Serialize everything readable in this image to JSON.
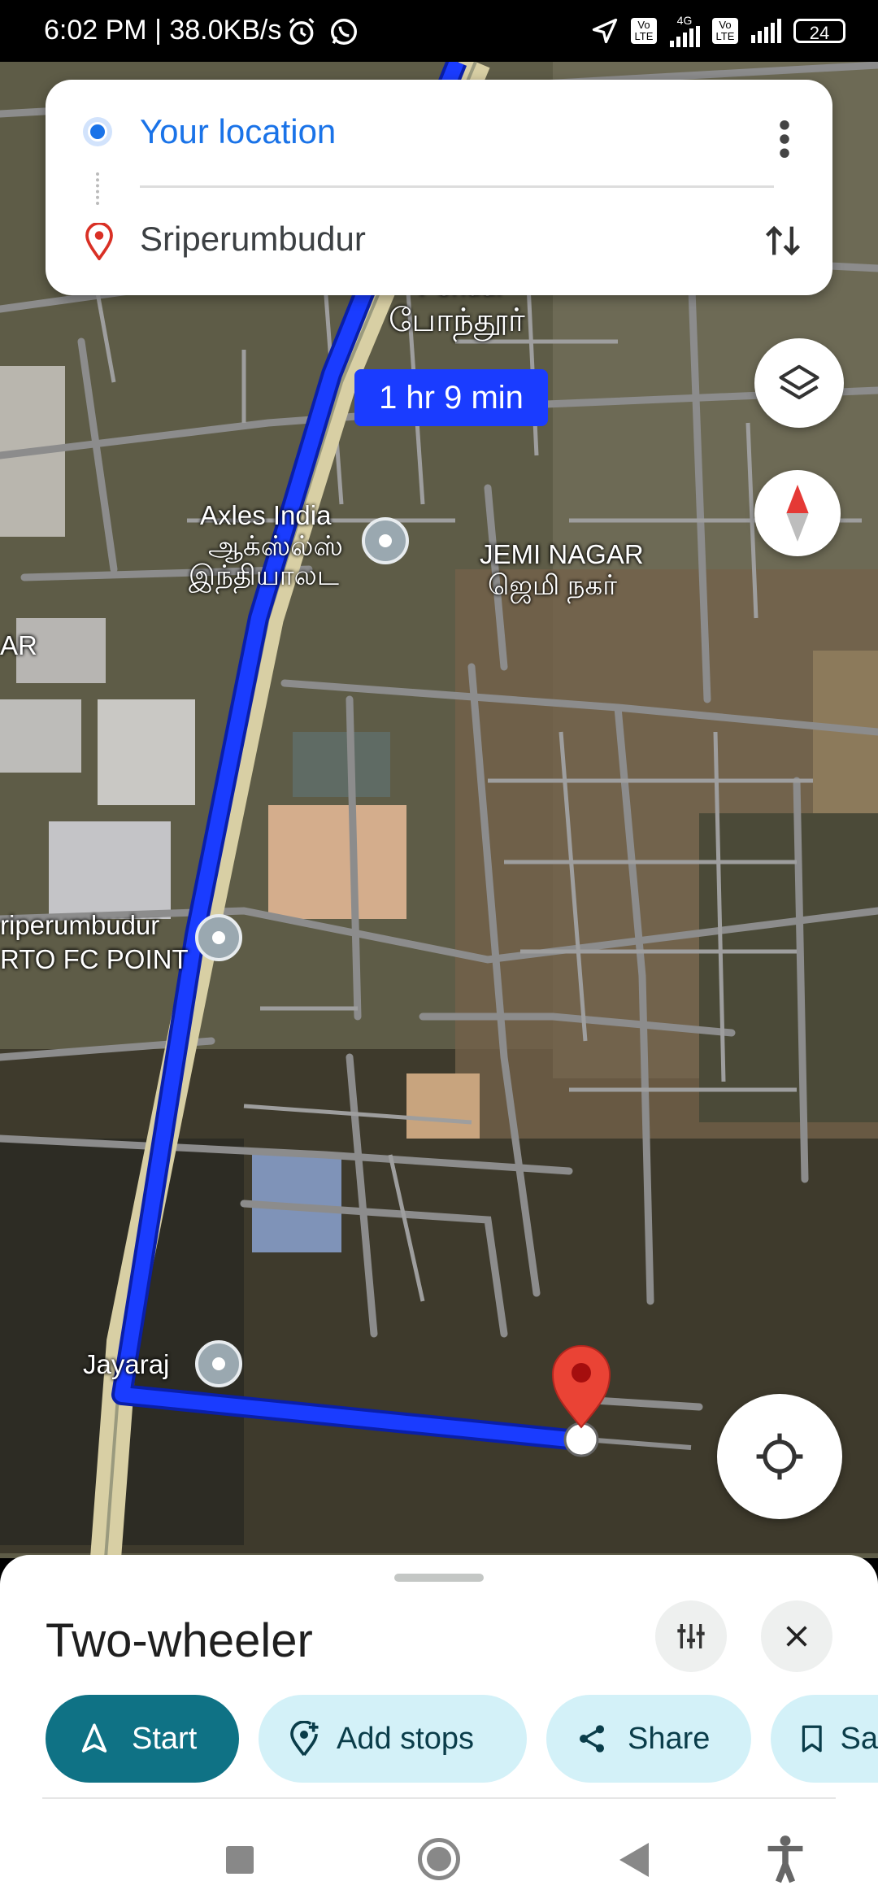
{
  "status_bar": {
    "time_speed": "6:02 PM | 38.0KB/s",
    "network": "4G",
    "volte_1": "Vo LTE",
    "volte_2": "Vo LTE",
    "battery": "24"
  },
  "directions": {
    "origin": "Your location",
    "destination": "Sriperumbudur",
    "route_duration": "1 hr 9 min"
  },
  "map_labels": {
    "pondur_en": "Pondur",
    "pondur_ta": "போந்தூர்",
    "axles_en": "Axles India",
    "axles_ta_1": "ஆக்ஸ்ல்ஸ்",
    "axles_ta_2": "இந்தியாலட",
    "jemi_en": "JEMI NAGAR",
    "jemi_ta": "ஜெமி நகர்",
    "ar": "AR",
    "rto_1": "riperumbudur",
    "rto_2": "RTO FC POINT",
    "jayaraj": "Jayaraj"
  },
  "sheet": {
    "mode_title": "Two-wheeler",
    "start": "Start",
    "add_stops": "Add stops",
    "share": "Share",
    "save": "Sa"
  },
  "colors": {
    "route": "#1a3cff",
    "accent_blue": "#1a73e8",
    "start_button": "#0f7285",
    "chip_bg": "#d3f1f8"
  }
}
